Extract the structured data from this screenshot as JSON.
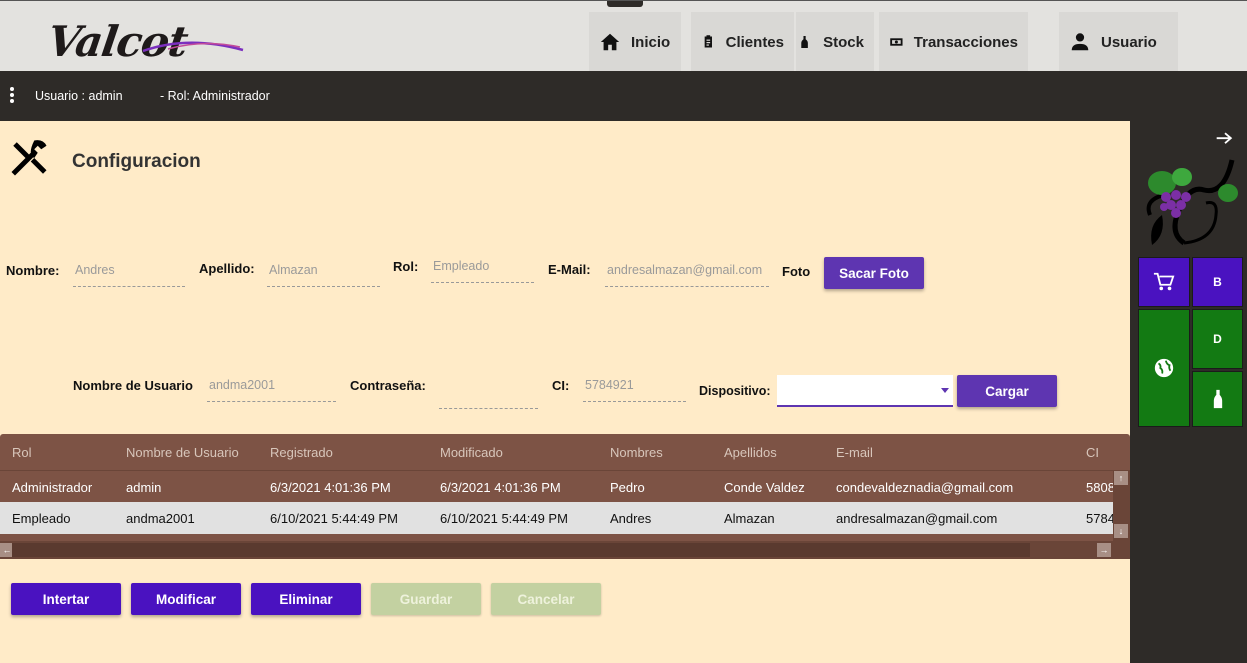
{
  "header": {
    "logo_text": "Valcot",
    "nav": [
      {
        "label": "Inicio",
        "icon": "home-icon"
      },
      {
        "label": "Clientes",
        "icon": "badge-icon"
      },
      {
        "label": "Stock",
        "icon": "bottle-icon"
      },
      {
        "label": "Transacciones",
        "icon": "money-icon"
      },
      {
        "label": "Usuario",
        "icon": "person-icon"
      }
    ]
  },
  "subbar": {
    "user_text": "Usuario : admin",
    "role_text": "- Rol: Administrador"
  },
  "page": {
    "title": "Configuracion"
  },
  "form": {
    "nombre_label": "Nombre:",
    "nombre_value": "Andres",
    "apellido_label": "Apellido:",
    "apellido_value": "Almazan",
    "rol_label": "Rol:",
    "rol_value": "Empleado",
    "email_label": "E-Mail:",
    "email_value": "andresalmazan@gmail.com",
    "foto_label": "Foto",
    "sacar_foto": "Sacar Foto",
    "usuario_label": "Nombre de Usuario",
    "usuario_value": "andma2001",
    "contrasena_label": "Contraseña:",
    "contrasena_value": "",
    "ci_label": "CI:",
    "ci_value": "5784921",
    "dispositivo_label": "Dispositivo:",
    "dispositivo_value": "",
    "cargar": "Cargar"
  },
  "table": {
    "columns": [
      "Rol",
      "Nombre de Usuario",
      "Registrado",
      "Modificado",
      "Nombres",
      "Apellidos",
      "E-mail",
      "CI"
    ],
    "rows": [
      [
        "Administrador",
        "admin",
        "6/3/2021 4:01:36 PM",
        "6/3/2021 4:01:36 PM",
        "Pedro",
        "Conde Valdez",
        "condevaldeznadia@gmail.com",
        "5808"
      ],
      [
        "Empleado",
        "andma2001",
        "6/10/2021 5:44:49 PM",
        "6/10/2021 5:44:49 PM",
        "Andres",
        "Almazan",
        "andresalmazan@gmail.com",
        "5784"
      ]
    ]
  },
  "actions": {
    "insertar": "Intertar",
    "modificar": "Modificar",
    "eliminar": "Eliminar",
    "guardar": "Guardar",
    "cancelar": "Cancelar"
  },
  "right_panel": {
    "tiles": [
      {
        "label": "",
        "icon": "cart-icon"
      },
      {
        "label": "B"
      },
      {
        "label": "",
        "icon": "globe-icon"
      },
      {
        "label": "D"
      },
      {
        "label": "",
        "icon": "bottle-icon"
      }
    ]
  },
  "colors": {
    "accent_purple": "#5e35b1",
    "tile_green": "#137a13",
    "main_bg": "#ffebc8",
    "grid_brown": "#7d5345"
  }
}
